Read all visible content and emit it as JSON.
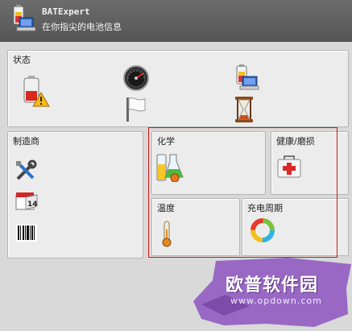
{
  "header": {
    "app_title": "BATExpert",
    "subtitle": "在你指尖的电池信息",
    "logo_icon": "laptop-battery-icon"
  },
  "status_panel": {
    "label": "状态",
    "icons": [
      "battery-warning-icon",
      "gauge-icon",
      "laptop-battery-icon",
      "white-flag-icon",
      "hourglass-icon"
    ]
  },
  "manufacturer_panel": {
    "label": "制造商",
    "icons": [
      "tools-icon",
      "calendar-icon",
      "barcode-icon"
    ],
    "calendar_day": "14"
  },
  "chemistry_panel": {
    "label": "化学",
    "icon": "chemistry-flasks-icon"
  },
  "health_panel": {
    "label": "健康/磨损",
    "icon": "first-aid-kit-icon"
  },
  "temperature_panel": {
    "label": "温度",
    "icon": "thermometer-icon"
  },
  "charge_cycle_panel": {
    "label": "充电周期",
    "icon": "charge-cycle-icon"
  },
  "watermark": {
    "text": "欧普软件园",
    "url": "www.opdown.com"
  },
  "colors": {
    "header": "#5e5e5e",
    "highlight": "#d01818",
    "watermark": "#8a4fc0"
  }
}
